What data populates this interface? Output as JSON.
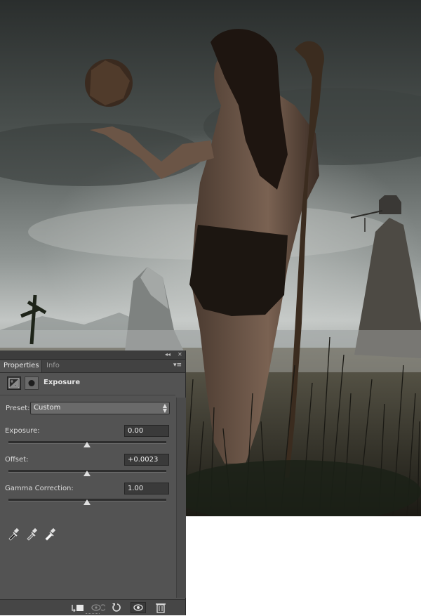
{
  "panel": {
    "tabs": [
      {
        "label": "Properties",
        "active": true
      },
      {
        "label": "Info",
        "active": false
      }
    ],
    "adjustment_title": "Exposure",
    "preset": {
      "label": "Preset:",
      "value": "Custom"
    },
    "fields": [
      {
        "label": "Exposure:",
        "value": "0.00",
        "slider_fraction": 0.5
      },
      {
        "label": "Offset:",
        "value": "+0.0023",
        "slider_fraction": 0.5
      },
      {
        "label": "Gamma Correction:",
        "value": "1.00",
        "slider_fraction": 0.5
      }
    ],
    "eyedroppers": [
      "black-point-eyedropper-icon",
      "gray-point-eyedropper-icon",
      "white-point-eyedropper-icon"
    ],
    "bottom_buttons": [
      "clip-to-layer-icon",
      "view-previous-state-icon",
      "reset-icon",
      "visibility-eye-icon",
      "trash-icon"
    ]
  },
  "colors": {
    "panel_bg": "#535353",
    "panel_dark": "#3a3a3a",
    "sky_dark": "#2f3433",
    "sky_light": "#b8bcbb"
  }
}
